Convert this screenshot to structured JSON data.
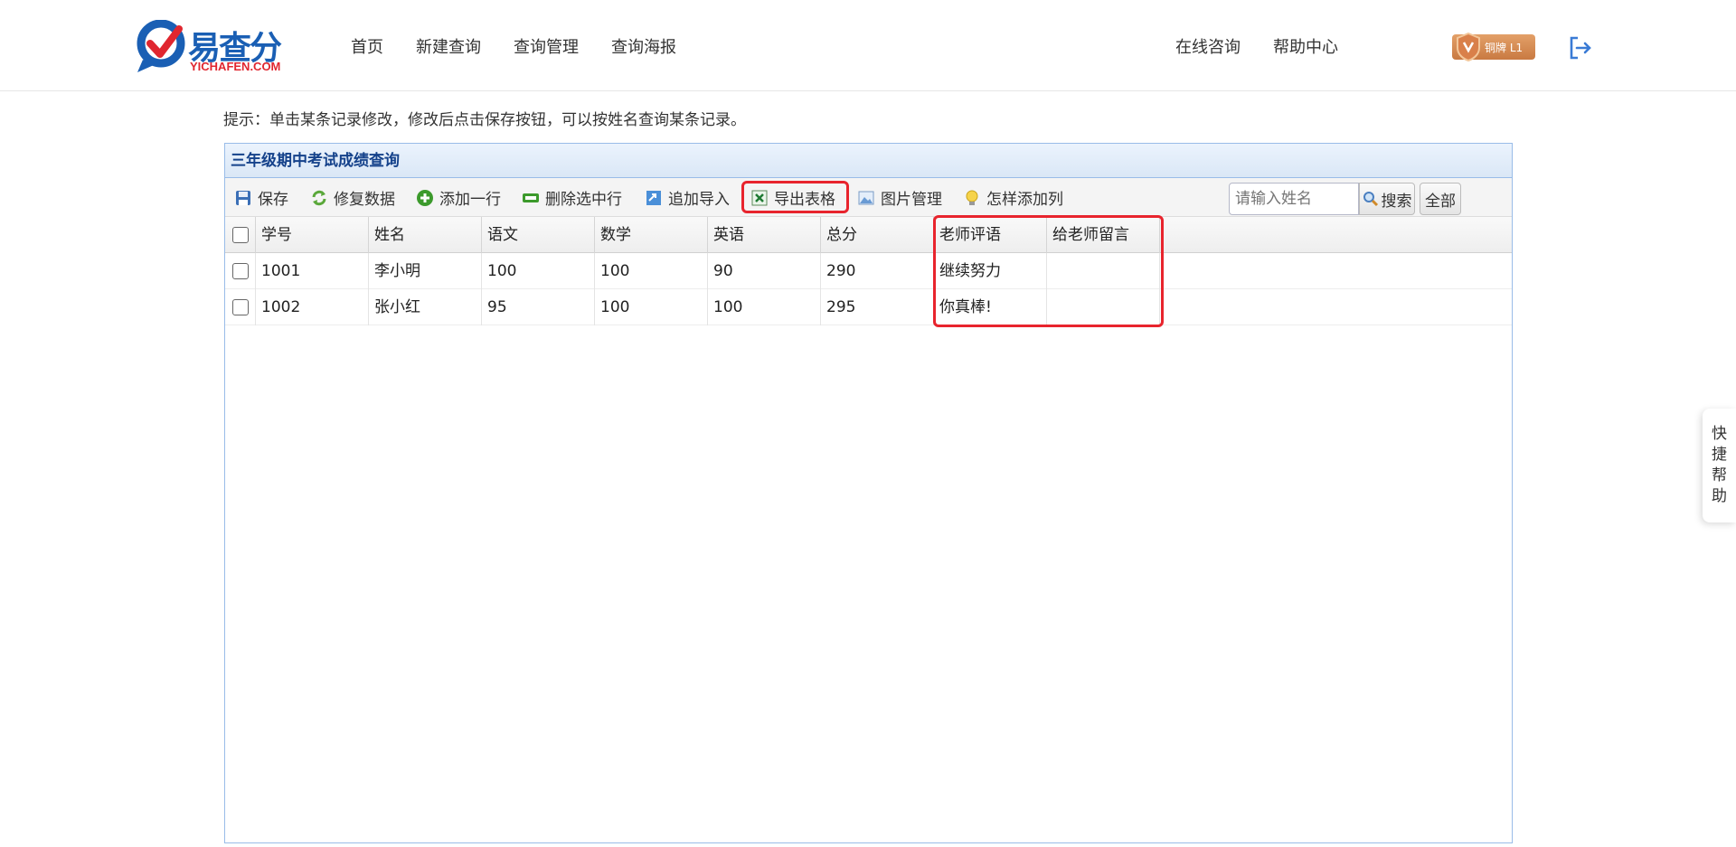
{
  "header": {
    "logo_cn": "易查分",
    "logo_en": "YICHAFEN.COM",
    "nav": [
      "首页",
      "新建查询",
      "查询管理",
      "查询海报"
    ],
    "right_nav": [
      "在线咨询",
      "帮助中心"
    ],
    "badge": "铜牌 L1"
  },
  "tip": "提示：单击某条记录修改，修改后点击保存按钮，可以按姓名查询某条记录。",
  "panel": {
    "title": "三年级期中考试成绩查询",
    "toolbar": {
      "save": "保存",
      "repair": "修复数据",
      "add_row": "添加一行",
      "delete_rows": "删除选中行",
      "append_import": "追加导入",
      "export": "导出表格",
      "images": "图片管理",
      "how_add_col": "怎样添加列",
      "search_placeholder": "请输入姓名",
      "search": "搜索",
      "all": "全部"
    },
    "columns": [
      "学号",
      "姓名",
      "语文",
      "数学",
      "英语",
      "总分",
      "老师评语",
      "给老师留言"
    ],
    "rows": [
      [
        "1001",
        "李小明",
        "100",
        "100",
        "90",
        "290",
        "继续努力",
        ""
      ],
      [
        "1002",
        "张小红",
        "95",
        "100",
        "100",
        "295",
        "你真棒!",
        ""
      ]
    ]
  },
  "quick_help": [
    "快",
    "捷",
    "帮",
    "助"
  ],
  "colors": {
    "brand_blue": "#1a5fb4",
    "brand_red": "#e0262f",
    "panel_border": "#99bce8",
    "highlight": "#e8242d"
  }
}
